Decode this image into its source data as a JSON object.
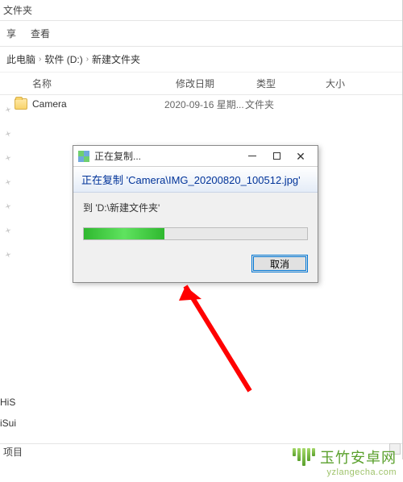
{
  "toolbar": {
    "folder_label": "文件夹",
    "share": "享",
    "view": "查看"
  },
  "breadcrumb": {
    "root": "此电脑",
    "drive": "软件 (D:)",
    "folder": "新建文件夹"
  },
  "columns": {
    "name": "名称",
    "date": "修改日期",
    "type": "类型",
    "size": "大小"
  },
  "files": [
    {
      "name": "Camera",
      "date": "2020-09-16 星期...",
      "type": "文件夹"
    }
  ],
  "side_labels": {
    "a": "HiS",
    "b": "iSui"
  },
  "items_label": "项目",
  "dialog": {
    "title": "正在复制...",
    "header_prefix": "正在复制 ",
    "header_file": "'Camera\\IMG_20200820_100512.jpg'",
    "dest_prefix": "到 ",
    "dest_path": "'D:\\新建文件夹'",
    "cancel": "取消",
    "progress_percent": 36
  },
  "watermark": {
    "brand": "玉竹安卓网",
    "url": "yzlangecha.com"
  }
}
